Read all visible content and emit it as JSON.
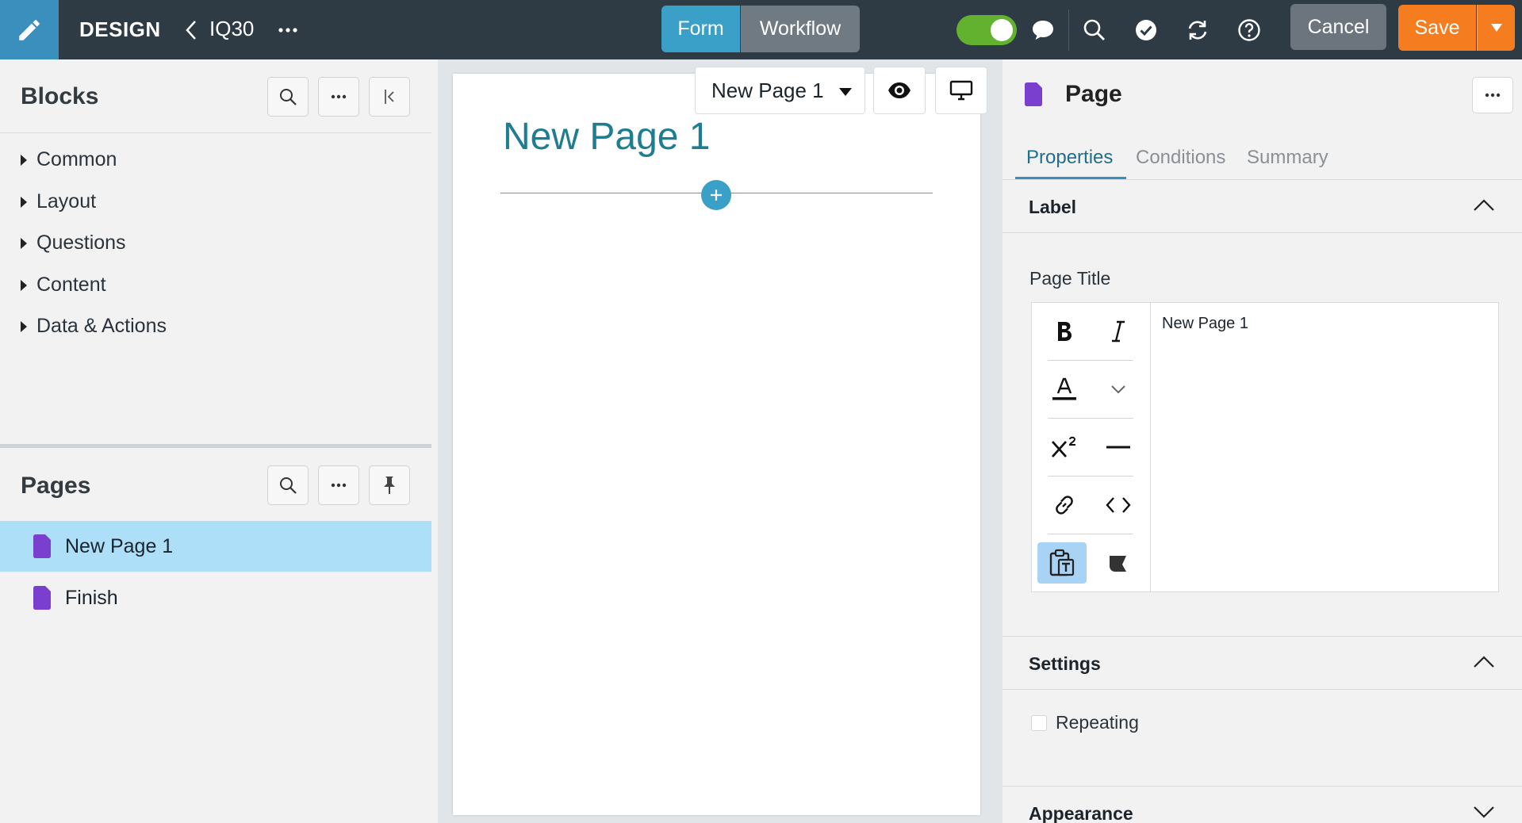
{
  "topbar": {
    "brand": "DESIGN",
    "form_name": "IQ30",
    "mode_tabs": {
      "form": "Form",
      "workflow": "Workflow"
    },
    "cancel_label": "Cancel",
    "save_label": "Save",
    "icons": [
      "pencil-icon",
      "chevron-left-icon",
      "ellipsis-icon",
      "chat-bubble-icon",
      "search-icon",
      "check-circle-icon",
      "refresh-icon",
      "help-icon",
      "caret-down-icon"
    ],
    "colors": {
      "bar": "#2e3a44",
      "brand_tile": "#3a8fbd",
      "form_active": "#3aa0c8",
      "toggle_on": "#62b22f",
      "save": "#f57c1f"
    }
  },
  "blocks": {
    "title": "Blocks",
    "items": [
      "Common",
      "Layout",
      "Questions",
      "Content",
      "Data & Actions"
    ]
  },
  "pages": {
    "title": "Pages",
    "items": [
      "New Page 1",
      "Finish"
    ],
    "selected": "New Page 1"
  },
  "canvas": {
    "page_title": "New Page 1",
    "page_selector": "New Page 1"
  },
  "properties": {
    "title": "Page",
    "tabs": [
      "Properties",
      "Conditions",
      "Summary"
    ],
    "active_tab": "Properties",
    "label_section": {
      "title": "Label",
      "field_label": "Page Title",
      "value": "New Page 1"
    },
    "settings_section": {
      "title": "Settings",
      "repeating_label": "Repeating"
    },
    "appearance_section": {
      "title": "Appearance"
    }
  }
}
